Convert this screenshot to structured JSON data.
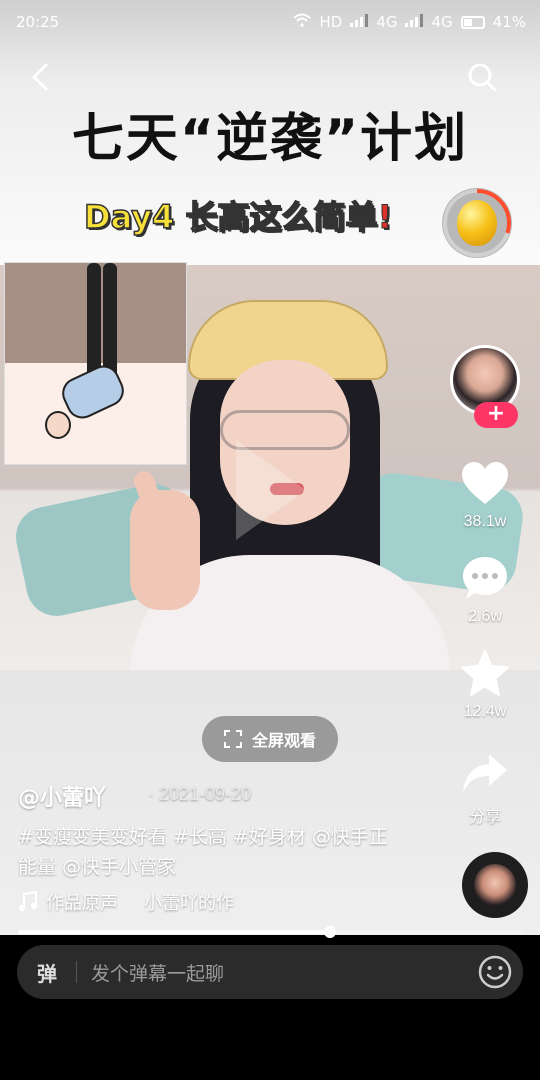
{
  "status_bar": {
    "time": "20:25",
    "network_label": "HD",
    "signal1": "4G",
    "signal2": "4G",
    "battery": "41%"
  },
  "video": {
    "title_main": "七天“逆袭”计划",
    "title_sub": "Day4 长高这么简单",
    "title_sub_bang": "!",
    "coin_progress": 0.3
  },
  "rail": {
    "follow_label": "+",
    "likes": "38.1w",
    "comments": "2.6w",
    "favorites": "12.4w",
    "share": "分享"
  },
  "fullscreen": {
    "label": "全屏观看"
  },
  "post": {
    "author": "@小蕾吖",
    "date": "· 2021-09-20",
    "caption": "#变瘦变美变好看 #长高 #好身材 @快手正能量 @快手小管家",
    "music_label": "作品原声",
    "music_source": "小蕾吖的作"
  },
  "playback": {
    "progress": 0.62
  },
  "comment_bar": {
    "danmaku_label": "弹",
    "placeholder": "发个弹幕一起聊"
  },
  "colors": {
    "accent": "#fe3666",
    "title_yellow": "#f8e03a",
    "bar_bg": "#2b2b2b"
  },
  "icons": [
    "back-icon",
    "search-icon",
    "wifi-icon",
    "signal-icon",
    "battery-icon",
    "heart-icon",
    "comment-icon",
    "star-icon",
    "share-icon",
    "music-note-icon",
    "fullscreen-icon",
    "emoji-icon",
    "coin-egg-icon",
    "disc-icon"
  ]
}
